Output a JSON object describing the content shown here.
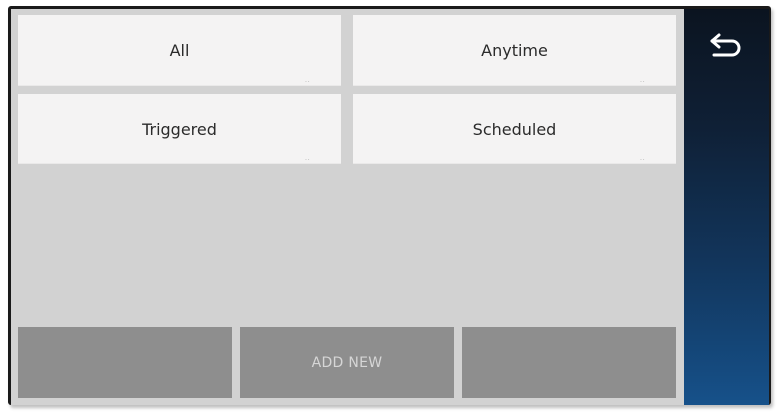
{
  "filters": {
    "all_label": "All",
    "anytime_label": "Anytime",
    "triggered_label": "Triggered",
    "scheduled_label": "Scheduled"
  },
  "actions": {
    "left_label": "",
    "add_new_label": "ADD NEW",
    "right_label": ""
  },
  "sidebar": {
    "back_icon": "back-arrow-icon"
  },
  "colors": {
    "panel_background": "#d2d2d2",
    "tile_background": "#f4f3f3",
    "button_background": "#8e8e8e",
    "sidebar_top": "#0b1420",
    "sidebar_bottom": "#16518a"
  }
}
